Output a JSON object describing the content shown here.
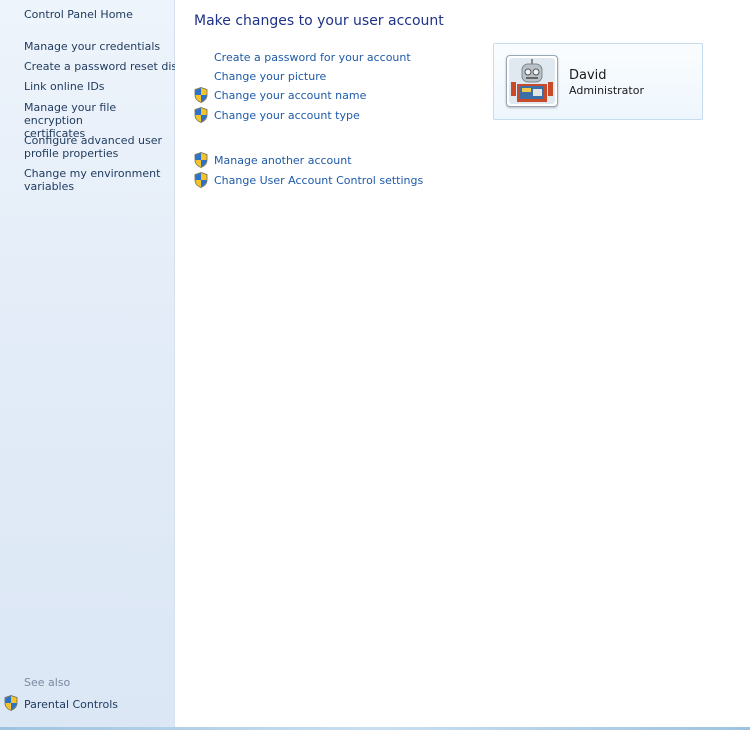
{
  "sidebar": {
    "home_link": "Control Panel Home",
    "links": [
      {
        "label": "Manage your credentials"
      },
      {
        "label": "Create a password reset disk"
      },
      {
        "label": "Link online IDs"
      },
      {
        "label": "Manage your file encryption\ncertificates"
      },
      {
        "label": "Configure advanced user\nprofile properties"
      },
      {
        "label": "Change my environment\nvariables"
      }
    ],
    "see_also_heading": "See also",
    "see_also": [
      {
        "label": "Parental Controls",
        "icon": "uac-shield-icon"
      }
    ]
  },
  "main": {
    "title": "Make changes to your user account",
    "tasks": [
      {
        "label": "Create a password for your account",
        "shield": false
      },
      {
        "label": "Change your picture",
        "shield": false
      },
      {
        "label": "Change your account name",
        "shield": true
      },
      {
        "label": "Change your account type",
        "shield": true
      }
    ],
    "other_tasks": [
      {
        "label": "Manage another account",
        "shield": true
      },
      {
        "label": "Change User Account Control settings",
        "shield": true
      }
    ]
  },
  "account": {
    "name": "David",
    "role": "Administrator",
    "picture": "robot-avatar"
  },
  "colors": {
    "link": "#1e5aa8",
    "title": "#1e3287",
    "sidebar_bg": "#e3ecf8"
  }
}
